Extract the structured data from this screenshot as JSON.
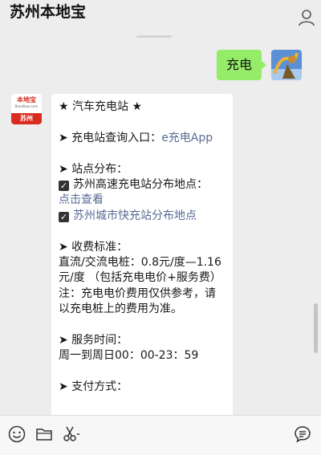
{
  "header": {
    "title": "苏州本地宝",
    "user_icon": "user-icon"
  },
  "chat": {
    "outgoing": {
      "text": "充电"
    },
    "incoming": {
      "avatar": {
        "logo_text": "本地宝",
        "logo_sub": "Bendibao.com",
        "city": "苏州"
      },
      "lines": [
        {
          "text": "★ 汽车充电站 ★"
        },
        {
          "text": ""
        },
        {
          "prefix": "➤ 充电站查询入口：",
          "link": "e充电App"
        },
        {
          "text": ""
        },
        {
          "text": "➤ 站点分布："
        },
        {
          "check": true,
          "text": "苏州高速充电站分布地点："
        },
        {
          "link": "点击查看"
        },
        {
          "check": true,
          "link": "苏州城市快充站分布地点"
        },
        {
          "text": ""
        },
        {
          "text": "➤ 收费标准："
        },
        {
          "text": "直流/交流电桩：0.8元/度—1.16元/度 （包括充电电价+服务费）"
        },
        {
          "text": "注：充电电价费用仅供参考，请以充电桩上的费用为准。"
        },
        {
          "text": ""
        },
        {
          "text": "➤ 服务时间："
        },
        {
          "text": "周一到周日00：00-23：59"
        },
        {
          "text": ""
        },
        {
          "text": "➤ 支付方式："
        }
      ]
    }
  },
  "toolbar": {
    "icons": [
      "emoji-icon",
      "folder-icon",
      "scissors-icon",
      "chat-history-icon"
    ]
  },
  "colors": {
    "background": "#ededed",
    "outgoing_bubble": "#95ec69",
    "incoming_bubble": "#ffffff",
    "link": "#576b95",
    "brand_red": "#d92c1f"
  }
}
